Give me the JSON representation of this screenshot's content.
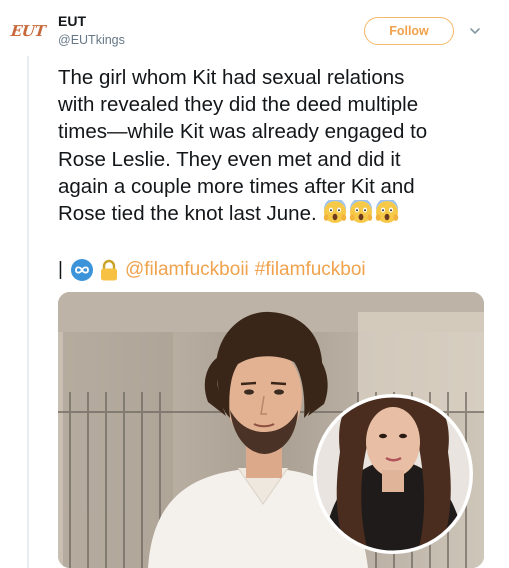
{
  "account": {
    "avatar_text": "EUT",
    "name": "EUT",
    "handle": "@EUTkings"
  },
  "follow_button": {
    "label": "Follow"
  },
  "tweet": {
    "text": "The girl whom Kit had sexual relations\nwith revealed they did the deed multiple\ntimes—while Kit was already engaged to\nRose Leslie. They even met and did it\nagain a couple more times after Kit and\nRose tied the knot last June.",
    "emoji": [
      "face-screaming-in-fear",
      "face-screaming-in-fear",
      "face-screaming-in-fear"
    ],
    "pipe": "|",
    "mention": "@filamfuckboii",
    "hashtag": "#filamfuckboi"
  },
  "media": {
    "description_icon": "photo-collage"
  },
  "colors": {
    "accent": "#f0a24c",
    "follow_border": "#f5b86a",
    "badge_blue": "#3b94d9",
    "lock_yellow": "#f7c244",
    "handle_gray": "#657786"
  }
}
